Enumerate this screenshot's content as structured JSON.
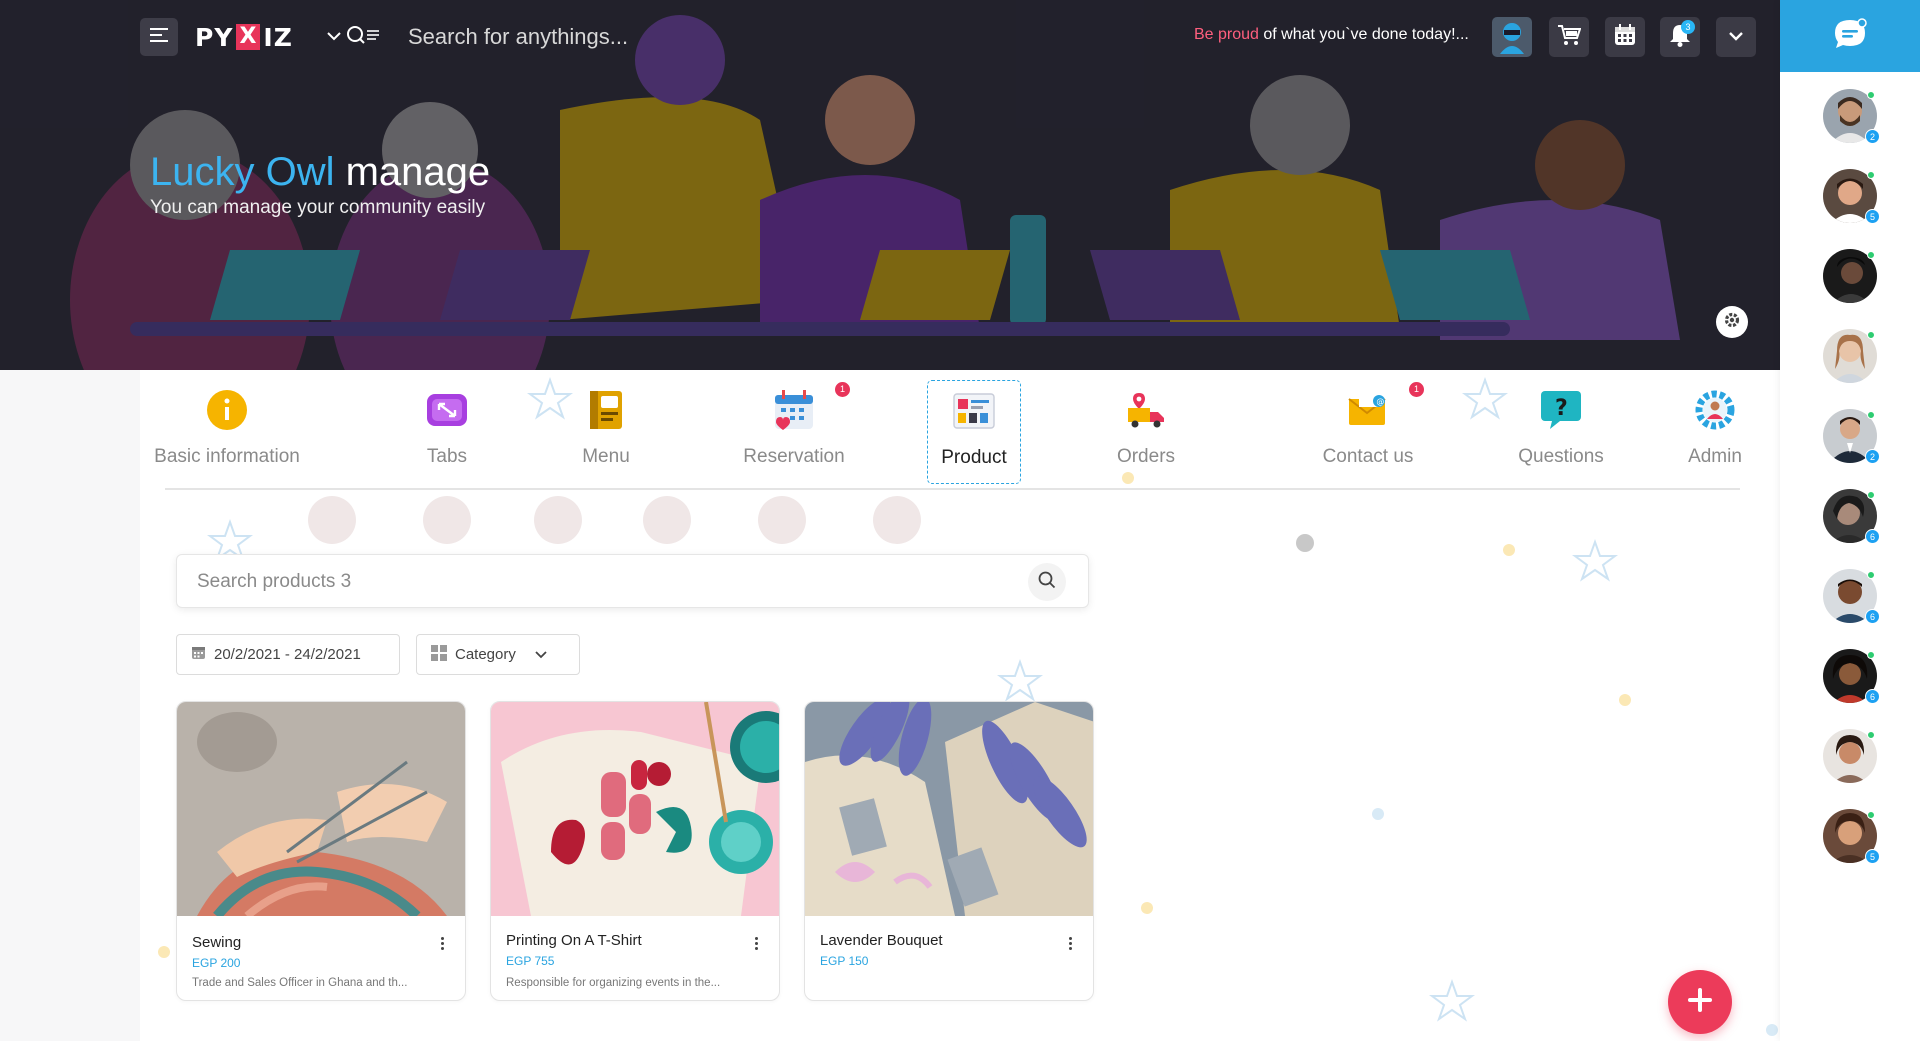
{
  "topbar": {
    "logo_left": "PY",
    "logo_x": "X",
    "logo_right": "IZ",
    "search_placeholder": "Search for anythings...",
    "motto_highlight": "Be proud",
    "motto_rest": " of what you`ve done today!...",
    "bell_count": "3",
    "icons": [
      "menu-icon",
      "chevron-down-icon",
      "search-filter-icon",
      "cart-icon",
      "calendar-icon",
      "bell-icon",
      "chevron-down-icon"
    ]
  },
  "hero": {
    "brand": "Lucky Owl",
    "title_rest": " manage",
    "subtitle": "You can manage your community easily"
  },
  "tabs": [
    {
      "label": "Basic information",
      "icon": "info-icon",
      "badge": ""
    },
    {
      "label": "Tabs",
      "icon": "tabs-icon",
      "badge": ""
    },
    {
      "label": "Menu",
      "icon": "menu-book-icon",
      "badge": ""
    },
    {
      "label": "Reservation",
      "icon": "reservation-calendar-icon",
      "badge": "1"
    },
    {
      "label": "Product",
      "icon": "product-icon",
      "badge": "",
      "active": true
    },
    {
      "label": "Orders",
      "icon": "delivery-truck-icon",
      "badge": ""
    },
    {
      "label": "Contact us",
      "icon": "mail-icon",
      "badge": "1"
    },
    {
      "label": "Questions",
      "icon": "question-icon",
      "badge": ""
    },
    {
      "label": "Admin",
      "icon": "admin-gear-icon",
      "badge": ""
    }
  ],
  "product_search": {
    "placeholder": "Search products 3"
  },
  "filters": {
    "date_range": "20/2/2021 - 24/2/2021",
    "category_label": "Category"
  },
  "products": [
    {
      "name": "Sewing",
      "price": "EGP 200",
      "description": "Trade and Sales Officer in Ghana and th..."
    },
    {
      "name": "Printing On A T-Shirt",
      "price": "EGP 755",
      "description": "Responsible for organizing events in the..."
    },
    {
      "name": "Lavender Bouquet",
      "price": "EGP 150",
      "description": ""
    }
  ],
  "contacts": [
    {
      "count": "2",
      "online": true
    },
    {
      "count": "5",
      "online": true
    },
    {
      "count": "",
      "online": true
    },
    {
      "count": "",
      "online": true
    },
    {
      "count": "2",
      "online": true
    },
    {
      "count": "6",
      "online": true
    },
    {
      "count": "6",
      "online": true
    },
    {
      "count": "6",
      "online": true
    },
    {
      "count": "",
      "online": true
    },
    {
      "count": "5",
      "online": true
    }
  ],
  "colors": {
    "accent_blue": "#2aa4e0",
    "brand_pink": "#e8345a",
    "hero_bg": "#262530",
    "add_button": "#ec3b5a"
  }
}
